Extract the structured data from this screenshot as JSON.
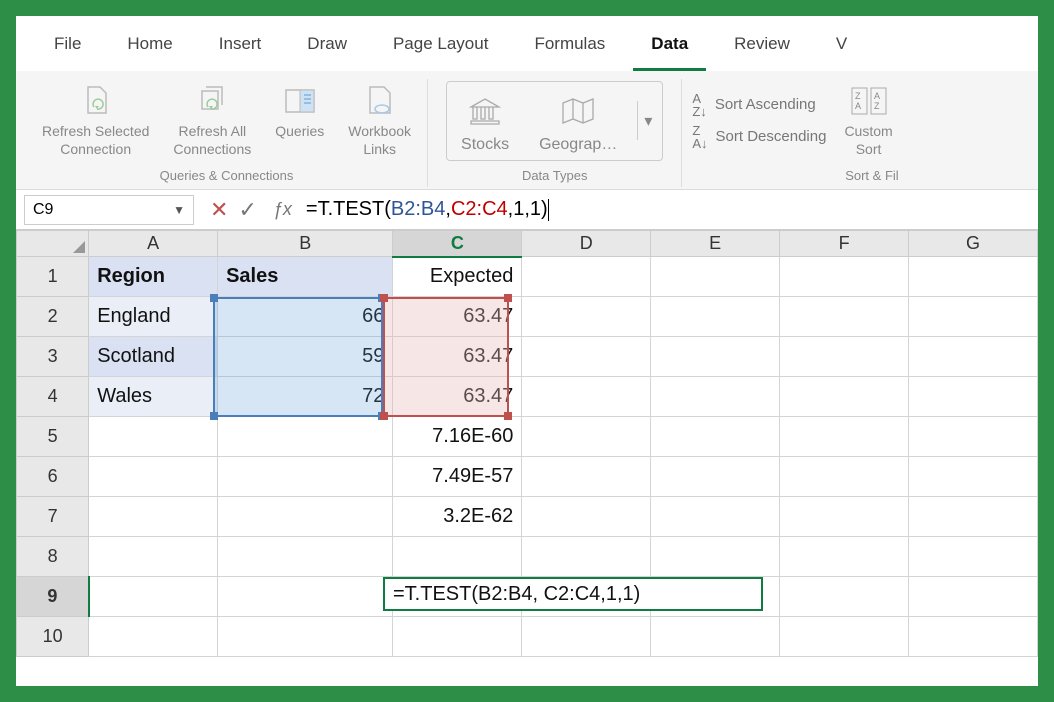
{
  "tabs": {
    "file": "File",
    "home": "Home",
    "insert": "Insert",
    "draw": "Draw",
    "page_layout": "Page Layout",
    "formulas": "Formulas",
    "data": "Data",
    "review": "Review",
    "view": "V"
  },
  "ribbon": {
    "queries_group": {
      "refresh_selected": "Refresh Selected\nConnection",
      "refresh_all": "Refresh All\nConnections",
      "queries": "Queries",
      "workbook_links": "Workbook\nLinks",
      "title": "Queries & Connections"
    },
    "data_types": {
      "stocks": "Stocks",
      "geography": "Geograp…",
      "title": "Data Types"
    },
    "sort": {
      "asc": "Sort Ascending",
      "desc": "Sort Descending",
      "custom": "Custom\nSort",
      "title": "Sort & Fil"
    }
  },
  "name_box": "C9",
  "formula": {
    "prefix": "=T.TEST(",
    "range1": "B2:B4",
    "sep1": ", ",
    "range2": "C2:C4",
    "suffix": ",1,1)"
  },
  "columns": [
    "A",
    "B",
    "C",
    "D",
    "E",
    "F",
    "G"
  ],
  "rows": [
    "1",
    "2",
    "3",
    "4",
    "5",
    "6",
    "7",
    "8",
    "9",
    "10"
  ],
  "cells": {
    "A1": "Region",
    "B1": "Sales",
    "C1": "Expected",
    "A2": "England",
    "B2": "66",
    "C2": "63.47",
    "A3": "Scotland",
    "B3": "59",
    "C3": "63.47",
    "A4": "Wales",
    "B4": "72",
    "C4": "63.47",
    "C5": "7.16E-60",
    "C6": "7.49E-57",
    "C7": "3.2E-62"
  },
  "editing_cell_text": "=T.TEST(B2:B4, C2:C4,1,1)"
}
